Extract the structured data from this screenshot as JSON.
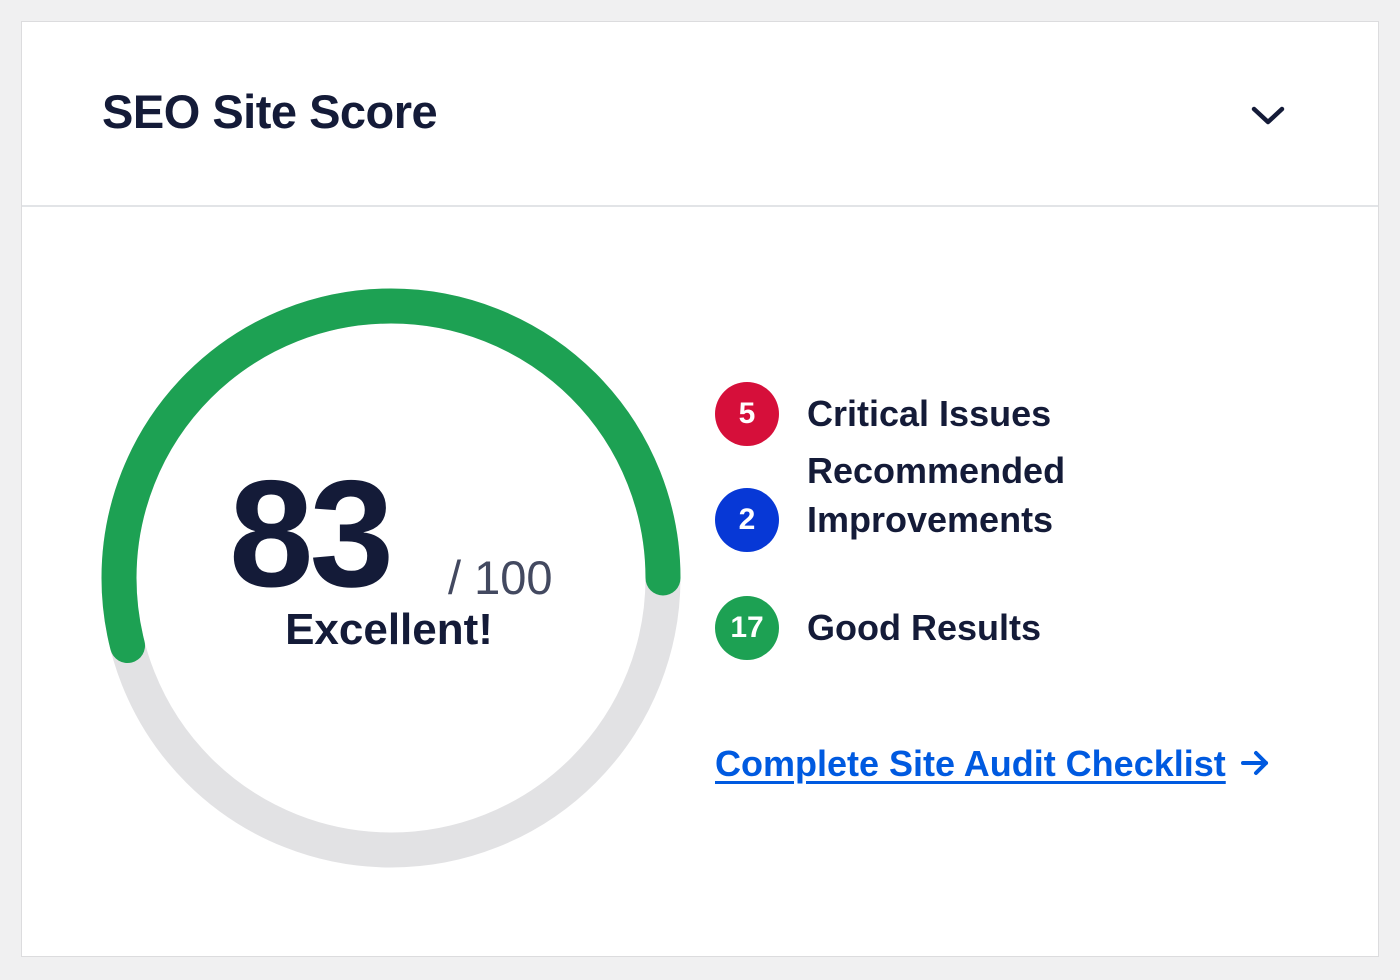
{
  "widget": {
    "title": "SEO Site Score",
    "toggle_icon": "chevron-down-icon"
  },
  "score": {
    "value": "83",
    "max_label": "/ 100",
    "rating": "Excellent!",
    "fraction": 0.83,
    "color_fill": "#1da153",
    "color_track": "#e2e2e4"
  },
  "results": [
    {
      "count": "5",
      "label": "Critical Issues",
      "color": "#d60f3a"
    },
    {
      "count": "2",
      "label": "Recommended Improvements",
      "label_line1": "Recommended",
      "label_line2": "Improvements",
      "color": "#0738d6"
    },
    {
      "count": "17",
      "label": "Good Results",
      "color": "#1da153"
    }
  ],
  "audit_link": {
    "label": "Complete Site Audit Checklist",
    "icon": "arrow-right-icon",
    "color": "#005ae0"
  }
}
